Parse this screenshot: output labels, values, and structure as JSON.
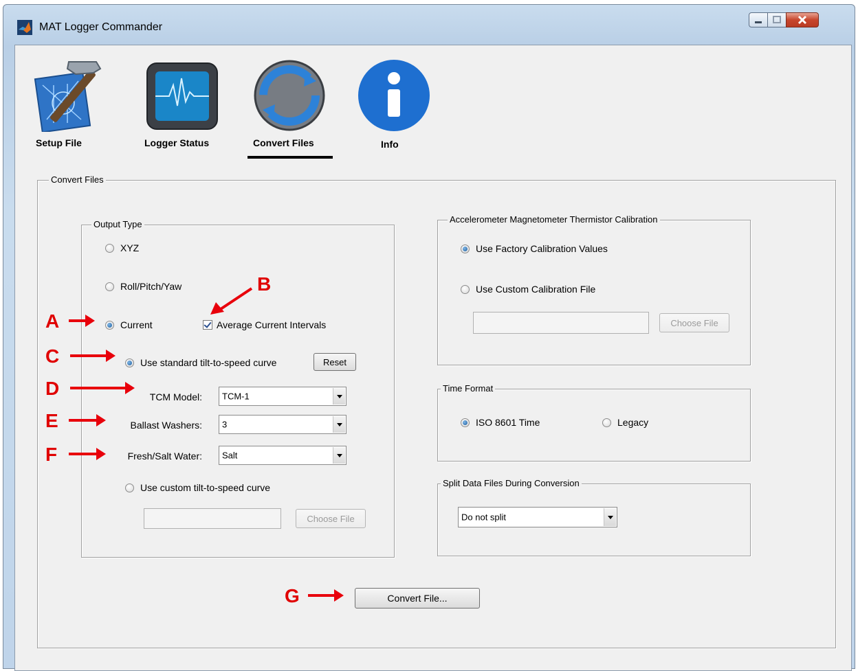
{
  "window": {
    "title": "MAT Logger Commander",
    "icon": "matlab-icon",
    "controls": [
      "minimize-icon",
      "maximize-icon",
      "close-icon"
    ]
  },
  "toolbar": {
    "items": [
      {
        "label": "Setup File",
        "icon": "hammer-blueprint-icon"
      },
      {
        "label": "Logger Status",
        "icon": "monitor-pulse-icon"
      },
      {
        "label": "Convert Files",
        "icon": "refresh-arrows-icon",
        "active": true
      },
      {
        "label": "Info",
        "icon": "info-icon"
      }
    ]
  },
  "convert_panel": {
    "title": "Convert Files",
    "output_type": {
      "title": "Output Type",
      "xyz": "XYZ",
      "rpy": "Roll/Pitch/Yaw",
      "current": "Current",
      "avg_current": "Average Current Intervals",
      "standard_curve": "Use standard tilt-to-speed curve",
      "reset": "Reset",
      "tcm_model_label": "TCM Model:",
      "tcm_model_value": "TCM-1",
      "ballast_label": "Ballast Washers:",
      "ballast_value": "3",
      "water_label": "Fresh/Salt Water:",
      "water_value": "Salt",
      "custom_curve": "Use custom tilt-to-speed curve",
      "choose_file": "Choose File"
    },
    "calibration": {
      "title": "Accelerometer Magnetometer Thermistor Calibration",
      "factory": "Use Factory Calibration Values",
      "custom": "Use Custom Calibration File",
      "choose_file": "Choose File"
    },
    "time_format": {
      "title": "Time Format",
      "iso": "ISO 8601 Time",
      "legacy": "Legacy"
    },
    "split": {
      "title": "Split Data Files During Conversion",
      "value": "Do not split"
    },
    "convert_button": "Convert File..."
  },
  "annotations": {
    "a": "A",
    "b": "B",
    "c": "C",
    "d": "D",
    "e": "E",
    "f": "F",
    "g": "G",
    "color": "#e8000b"
  },
  "colors": {
    "titlebar": "#c9dcee",
    "client_bg": "#f0f0f0",
    "active_underline": "#000000"
  }
}
